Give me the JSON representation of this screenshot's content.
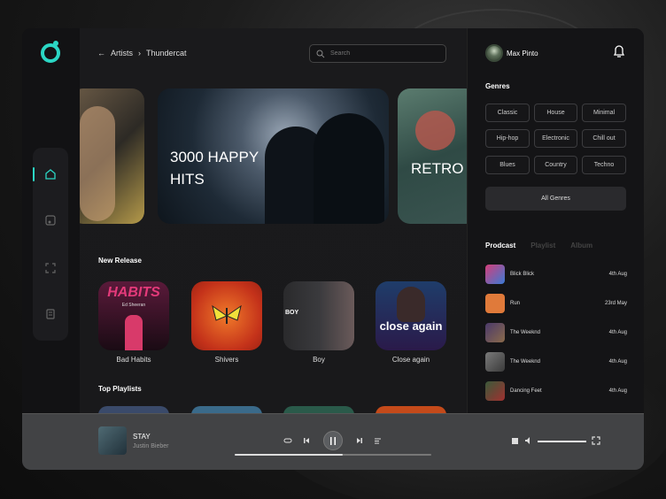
{
  "breadcrumb": {
    "parent": "Artists",
    "current": "Thundercat"
  },
  "search": {
    "placeholder": "Search"
  },
  "banners": [
    {
      "title": ""
    },
    {
      "title": "3000 HAPPY HITS"
    },
    {
      "title": "RETRO"
    }
  ],
  "sections": {
    "new_release": "New Release",
    "top_playlists": "Top Playlists"
  },
  "albums": [
    {
      "label": "Bad Habits",
      "art_text": "HABITS",
      "art_sub": "Ed Sheeran"
    },
    {
      "label": "Shivers",
      "art_text": "",
      "art_sub": ""
    },
    {
      "label": "Boy",
      "art_text": "BOY",
      "art_sub": ""
    },
    {
      "label": "Close again",
      "art_text": "close again",
      "art_sub": ""
    }
  ],
  "profile": {
    "name": "Max Pinto"
  },
  "genres": {
    "title": "Genres",
    "items": [
      "Classic",
      "House",
      "Minimal",
      "Hip-hop",
      "Electronic",
      "Chill out",
      "Blues",
      "Country",
      "Techno"
    ],
    "all_label": "All Genres"
  },
  "tabs": [
    "Prodcast",
    "Playlist",
    "Album"
  ],
  "podcasts": [
    {
      "name": "Blick Blick",
      "date": "4th Aug",
      "color": "#d43f7a"
    },
    {
      "name": "Run",
      "date": "23rd May",
      "color": "#e07a3a"
    },
    {
      "name": "The Weeknd",
      "date": "4th Aug",
      "color": "#4b3a6b"
    },
    {
      "name": "The Weeknd",
      "date": "4th Aug",
      "color": "#6a6a6a"
    },
    {
      "name": "Dancing Feet",
      "date": "4th Aug",
      "color": "#3a5a3a"
    }
  ],
  "player": {
    "title": "STAY",
    "artist": "Justin Bieber",
    "progress": 0.55,
    "volume": 1.0
  },
  "colors": {
    "accent": "#2bd6c4"
  }
}
